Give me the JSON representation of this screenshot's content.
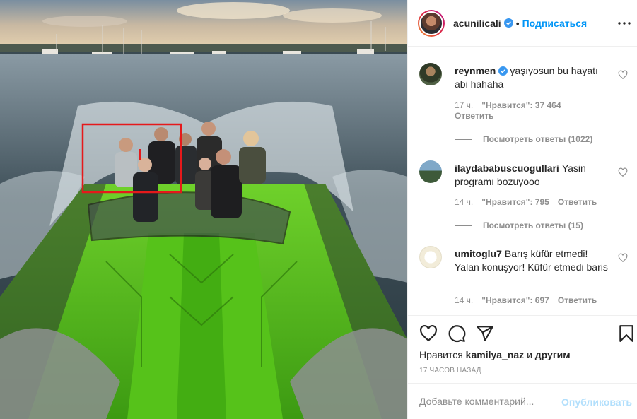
{
  "post": {
    "author": "acunilicali",
    "follow_label": "Подписаться",
    "separator": "•"
  },
  "comments": [
    {
      "user": "reynmen",
      "verified": true,
      "text": "yaşıyosun bu hayatı abi hahaha",
      "time": "17 ч.",
      "likes": "\"Нравится\": 37 464",
      "reply": "Ответить",
      "view_replies": "Посмотреть ответы (1022)"
    },
    {
      "user": "ilaydababuscuogullari",
      "verified": false,
      "text": "Yasin programı bozuyooo",
      "time": "14 ч.",
      "likes": "\"Нравится\": 795",
      "reply": "Ответить",
      "view_replies": "Посмотреть ответы (15)"
    },
    {
      "user": "umitoglu7",
      "verified": false,
      "text": "Barış küfür etmedi! Yalan konuşyor! Küfür etmedi baris",
      "time": "14 ч.",
      "likes": "\"Нравится\": 697",
      "reply": "Ответить"
    }
  ],
  "footer": {
    "likes_prefix": "Нравится",
    "liked_by": "kamilya_naz",
    "likes_and": "и",
    "likes_others": "другим",
    "timestamp": "17 часов назад",
    "comment_placeholder": "Добавьте комментарий...",
    "publish_label": "Опубликовать"
  },
  "icons": {
    "header": [
      "verified-badge-icon",
      "more-options-icon"
    ],
    "actions": [
      "heart-icon",
      "comment-icon",
      "share-icon",
      "bookmark-icon"
    ]
  },
  "colors": {
    "accent": "#0095f6",
    "publish_disabled": "#b2dffc",
    "muted": "#8e8e8e",
    "text": "#262626",
    "highlight_box": "#e5191b"
  }
}
